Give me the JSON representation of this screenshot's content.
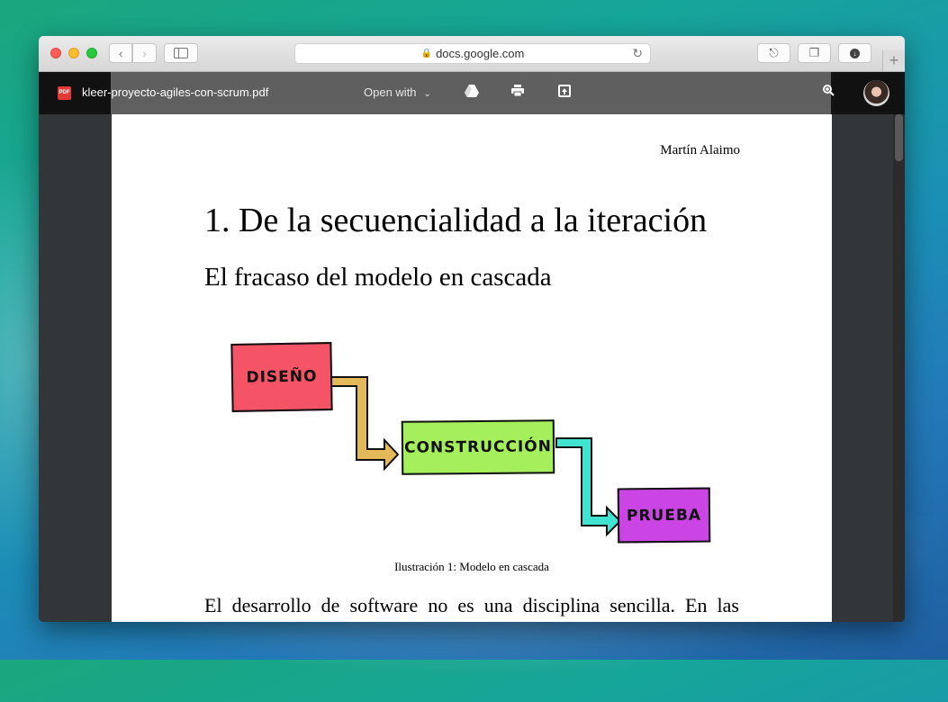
{
  "browser": {
    "url": "docs.google.com"
  },
  "viewer": {
    "filename": "kleer-proyecto-agiles-con-scrum.pdf",
    "pdf_badge": "PDF",
    "open_with": "Open with"
  },
  "document": {
    "author": "Martín Alaimo",
    "heading": "1. De la secuencialidad a la iteración",
    "subheading": "El fracaso del modelo en cascada",
    "figure": {
      "boxes": [
        "DISEÑO",
        "CONSTRUCCIÓN",
        "PRUEBA"
      ],
      "caption": "Ilustración 1: Modelo en cascada",
      "colors": {
        "diseno": "#f55466",
        "construccion": "#a6ef5c",
        "prueba": "#cb44e4"
      }
    },
    "body_line": "El desarrollo de software no es una disciplina sencilla. En las"
  }
}
